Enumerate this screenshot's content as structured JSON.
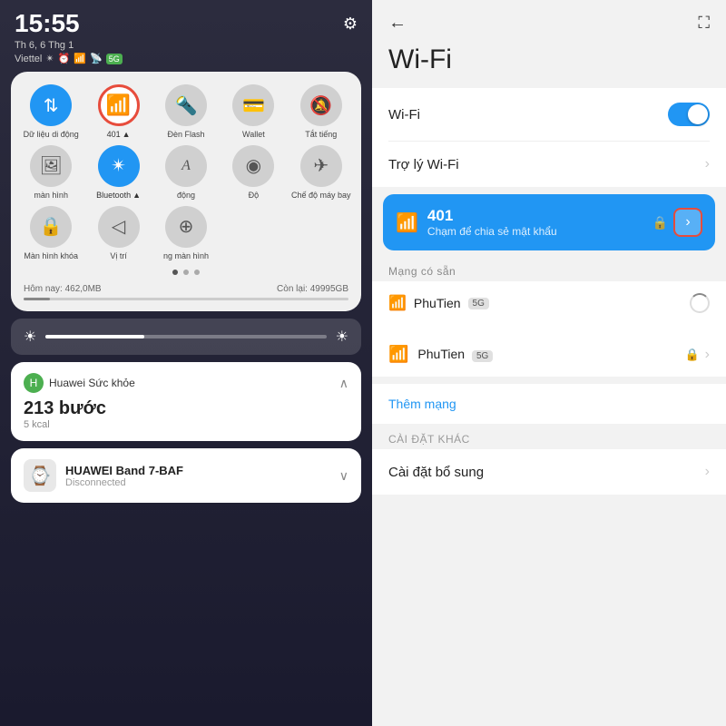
{
  "left": {
    "time": "15:55",
    "day": "Th 6, 6 Thg 1",
    "carrier": "Viettel",
    "gear": "⚙",
    "quick_items": [
      {
        "id": "mobile-data",
        "icon": "📶",
        "label": "Dữ liệu di động",
        "active": true
      },
      {
        "id": "wifi",
        "icon": "📶",
        "label": "401",
        "active": true,
        "selected": true,
        "badge": "401"
      },
      {
        "id": "flash",
        "icon": "🔦",
        "label": "Đèn Flash",
        "active": false
      },
      {
        "id": "wallet",
        "icon": "💳",
        "label": "Wallet",
        "active": false
      },
      {
        "id": "silent",
        "icon": "🔕",
        "label": "Tắt tiếng",
        "active": false
      },
      {
        "id": "screen",
        "icon": "🖼",
        "label": "màn hình",
        "active": false
      },
      {
        "id": "bluetooth",
        "icon": "🔵",
        "label": "Bluetooth",
        "active": true
      },
      {
        "id": "auto",
        "icon": "A",
        "label": "động",
        "active": false
      },
      {
        "id": "extra1",
        "icon": "◉",
        "label": "Độ",
        "active": false
      },
      {
        "id": "airplane",
        "icon": "✈",
        "label": "Chế độ máy bay",
        "active": false
      },
      {
        "id": "lockscreen",
        "icon": "🔒",
        "label": "Màn hình khóa",
        "active": false
      },
      {
        "id": "location",
        "icon": "📍",
        "label": "Vị trí",
        "active": false
      },
      {
        "id": "screen2",
        "icon": "📺",
        "label": "ng màn hình",
        "active": false
      }
    ],
    "storage_today": "Hôm nay: 462,0MB",
    "storage_left": "Còn lại: 49995GB",
    "health": {
      "title": "Huawei Sức khỏe",
      "steps": "213 bước",
      "kcal": "5 kcal"
    },
    "band": {
      "title": "HUAWEI Band 7-BAF",
      "status": "Disconnected"
    }
  },
  "right": {
    "title": "Wi-Fi",
    "back_icon": "←",
    "expand_icon": "⛶",
    "wifi_label": "Wi-Fi",
    "assistant_label": "Trợ lý Wi-Fi",
    "connected": {
      "name": "401",
      "sub": "Chạm để chia sẻ mật khẩu"
    },
    "available_label": "Mạng có sẵn",
    "networks": [
      {
        "name": "PhuTien",
        "badge": "5G",
        "locked": true
      }
    ],
    "add_network": "Thêm mạng",
    "other_section": "CÀI ĐẶT KHÁC",
    "other_setting": "Cài đặt bổ sung"
  }
}
